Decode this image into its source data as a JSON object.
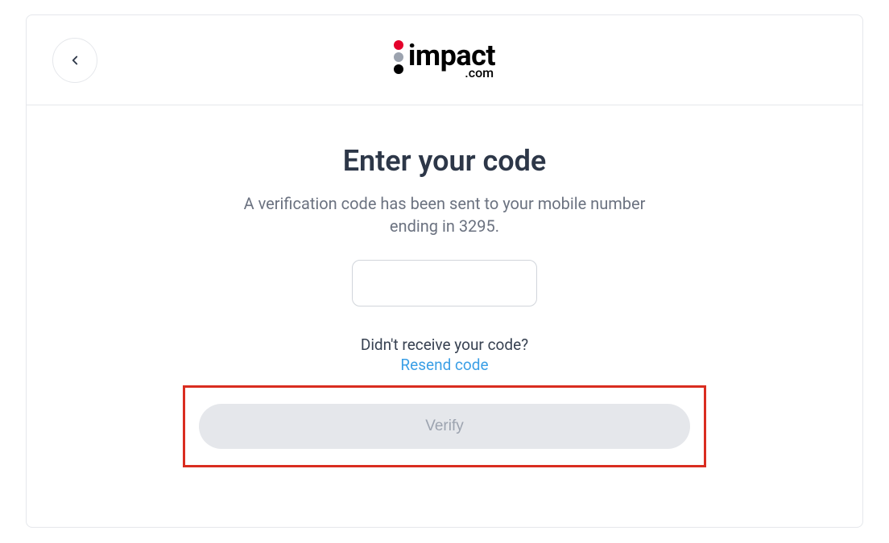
{
  "logo": {
    "main": "impact",
    "sub": ".com"
  },
  "page": {
    "title": "Enter your code",
    "subtitle": "A verification code has been sent to your mobile number ending in 3295.",
    "didnt_receive": "Didn't receive your code?",
    "resend_label": "Resend code",
    "verify_label": "Verify"
  }
}
